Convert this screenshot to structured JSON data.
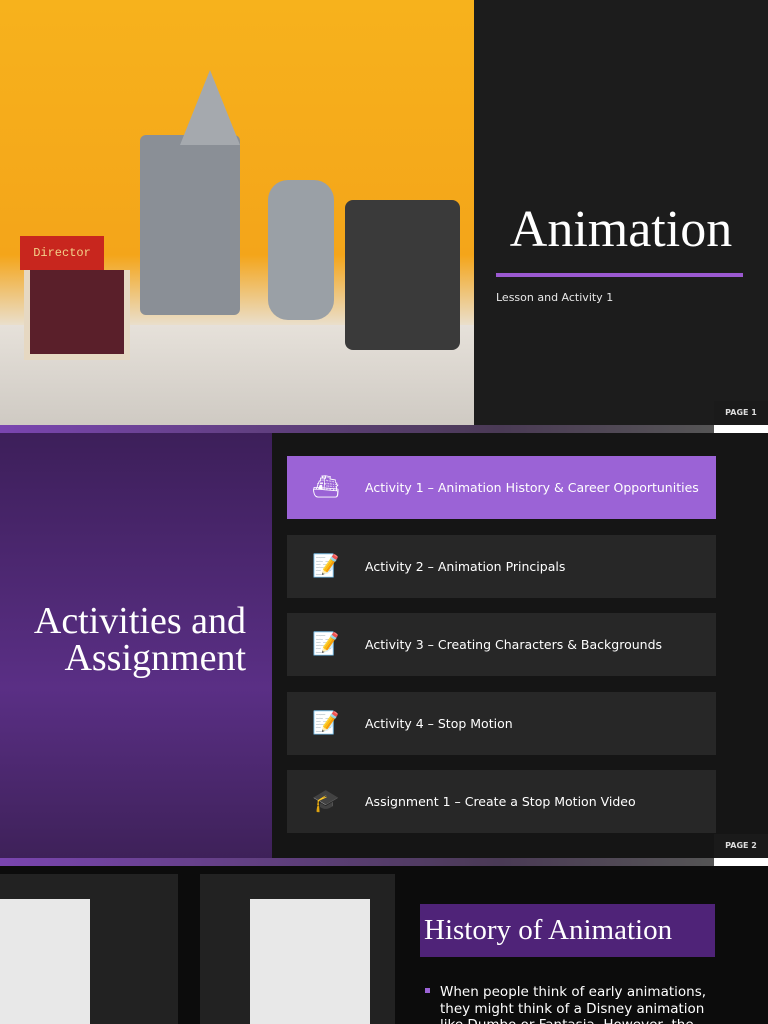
{
  "slide1": {
    "title": "Animation",
    "subtitle": "Lesson and Activity 1",
    "page": "PAGE 1",
    "photo_sign": "Director",
    "accent": "#9b59d0"
  },
  "slide2": {
    "title_line1": "Activities and",
    "title_line2": "Assignment",
    "page": "PAGE 2",
    "items": [
      {
        "label": "Activity 1 – Animation History & Career Opportunities",
        "icon": "ship-icon",
        "active": true
      },
      {
        "label": "Activity 2 – Animation Principals",
        "icon": "checklist-icon"
      },
      {
        "label": "Activity 3 – Creating Characters & Backgrounds",
        "icon": "checklist-icon"
      },
      {
        "label": "Activity 4 – Stop Motion",
        "icon": "checklist-icon"
      },
      {
        "label": "Assignment 1 – Create a Stop Motion Video",
        "icon": "graduation-cap-icon"
      }
    ]
  },
  "slide3": {
    "title": "History of Animation",
    "bullet": "When people think of early animations, they might think of a Disney animation like Dumbo or Fantasia. However, the"
  }
}
